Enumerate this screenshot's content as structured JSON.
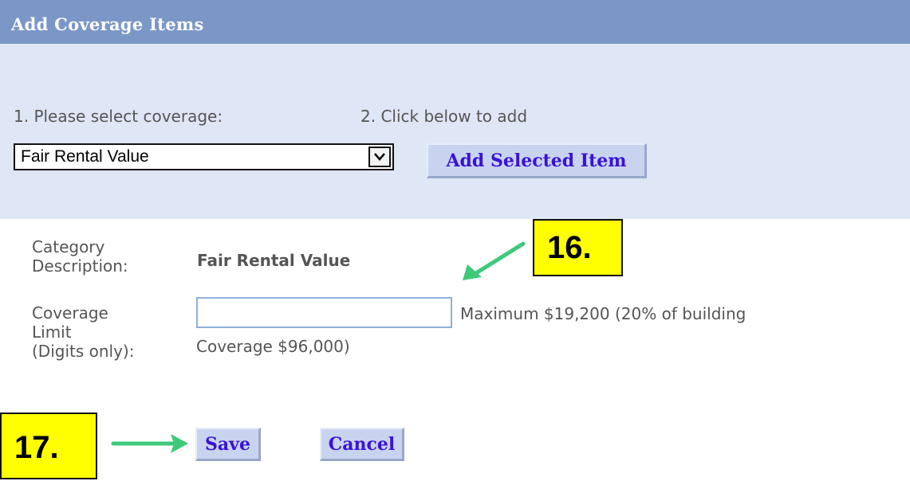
{
  "header": {
    "title": "Add Coverage Items"
  },
  "steps": {
    "select_label": "1. Please select coverage:",
    "add_label": "2. Click below to add"
  },
  "coverage_select": {
    "selected": "Fair Rental Value"
  },
  "buttons": {
    "add_selected": "Add Selected Item",
    "save": "Save",
    "cancel": "Cancel"
  },
  "form": {
    "category_label": "Category\nDescription:",
    "category_value": "Fair Rental Value",
    "limit_label": "Coverage\nLimit\n(Digits only):",
    "limit_value": "",
    "limit_hint_line1": "Maximum $19,200 (20% of building",
    "limit_hint_line2": "Coverage $96,000)"
  },
  "callouts": {
    "step16": "16.",
    "step17": "17."
  },
  "colors": {
    "header_bg": "#7b97c7",
    "panel_bg": "#dfe6f5",
    "button_bg": "#c8d4ef",
    "button_text": "#3a12d6",
    "callout_bg": "#ffff00",
    "arrow": "#3ec97a"
  }
}
